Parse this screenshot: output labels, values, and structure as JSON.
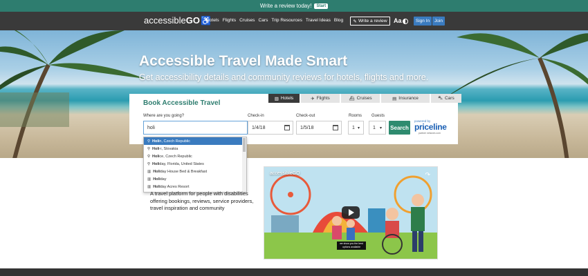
{
  "review_bar": {
    "text": "Write a review today!",
    "start": "Start"
  },
  "nav": {
    "logo_text": "accessible",
    "logo_bold": "GO",
    "links": [
      "Hotels",
      "Flights",
      "Cruises",
      "Cars",
      "Trip Resources",
      "Travel Ideas",
      "Blog"
    ],
    "write_review": "Write a review",
    "font_size": "Aa",
    "sign_in": "Sign In",
    "join": "Join"
  },
  "hero": {
    "title": "Accessible Travel Made Smart",
    "subtitle": "Get accessibility details and community reviews for hotels, flights and more."
  },
  "booking": {
    "title": "Book Accessible Travel",
    "tabs": [
      "Hotels",
      "Flights",
      "Cruises",
      "Insurance",
      "Cars"
    ],
    "destination_label": "Where are you going?",
    "destination_value": "holi",
    "checkin_label": "Check-in",
    "checkin_value": "1/4/18",
    "checkout_label": "Check-out",
    "checkout_value": "1/5/18",
    "rooms_label": "Rooms",
    "rooms_value": "1",
    "guests_label": "Guests",
    "guests_value": "1",
    "search": "Search",
    "powered_by": "powered by",
    "priceline": "priceline",
    "priceline_sub": "partner network.com"
  },
  "suggestions": [
    {
      "match": "Holi",
      "rest": "n, Czech Republic",
      "icon": "pin"
    },
    {
      "match": "Holi",
      "rest": "-i, Slovakia",
      "icon": "pin"
    },
    {
      "match": "Holi",
      "rest": "ce, Czech Republic",
      "icon": "pin"
    },
    {
      "match": "Holi",
      "rest": "day, Florida, United States",
      "icon": "pin"
    },
    {
      "match": "Holi",
      "rest": "day House Bed & Breakfast",
      "icon": "building"
    },
    {
      "match": "Holi",
      "rest": "day",
      "icon": "building"
    },
    {
      "match": "Holi",
      "rest": "day Acres Resort",
      "icon": "building"
    }
  ],
  "description": "A travel platform for people with disabilities offering bookings, reviews, service providers, travel inspiration and community",
  "video": {
    "title": "accessibleGO",
    "caption": "we show you the best options available"
  },
  "colors": {
    "accent": "#2e7d6f",
    "nav": "#3a3a3a",
    "link_blue": "#3a7bbf"
  }
}
